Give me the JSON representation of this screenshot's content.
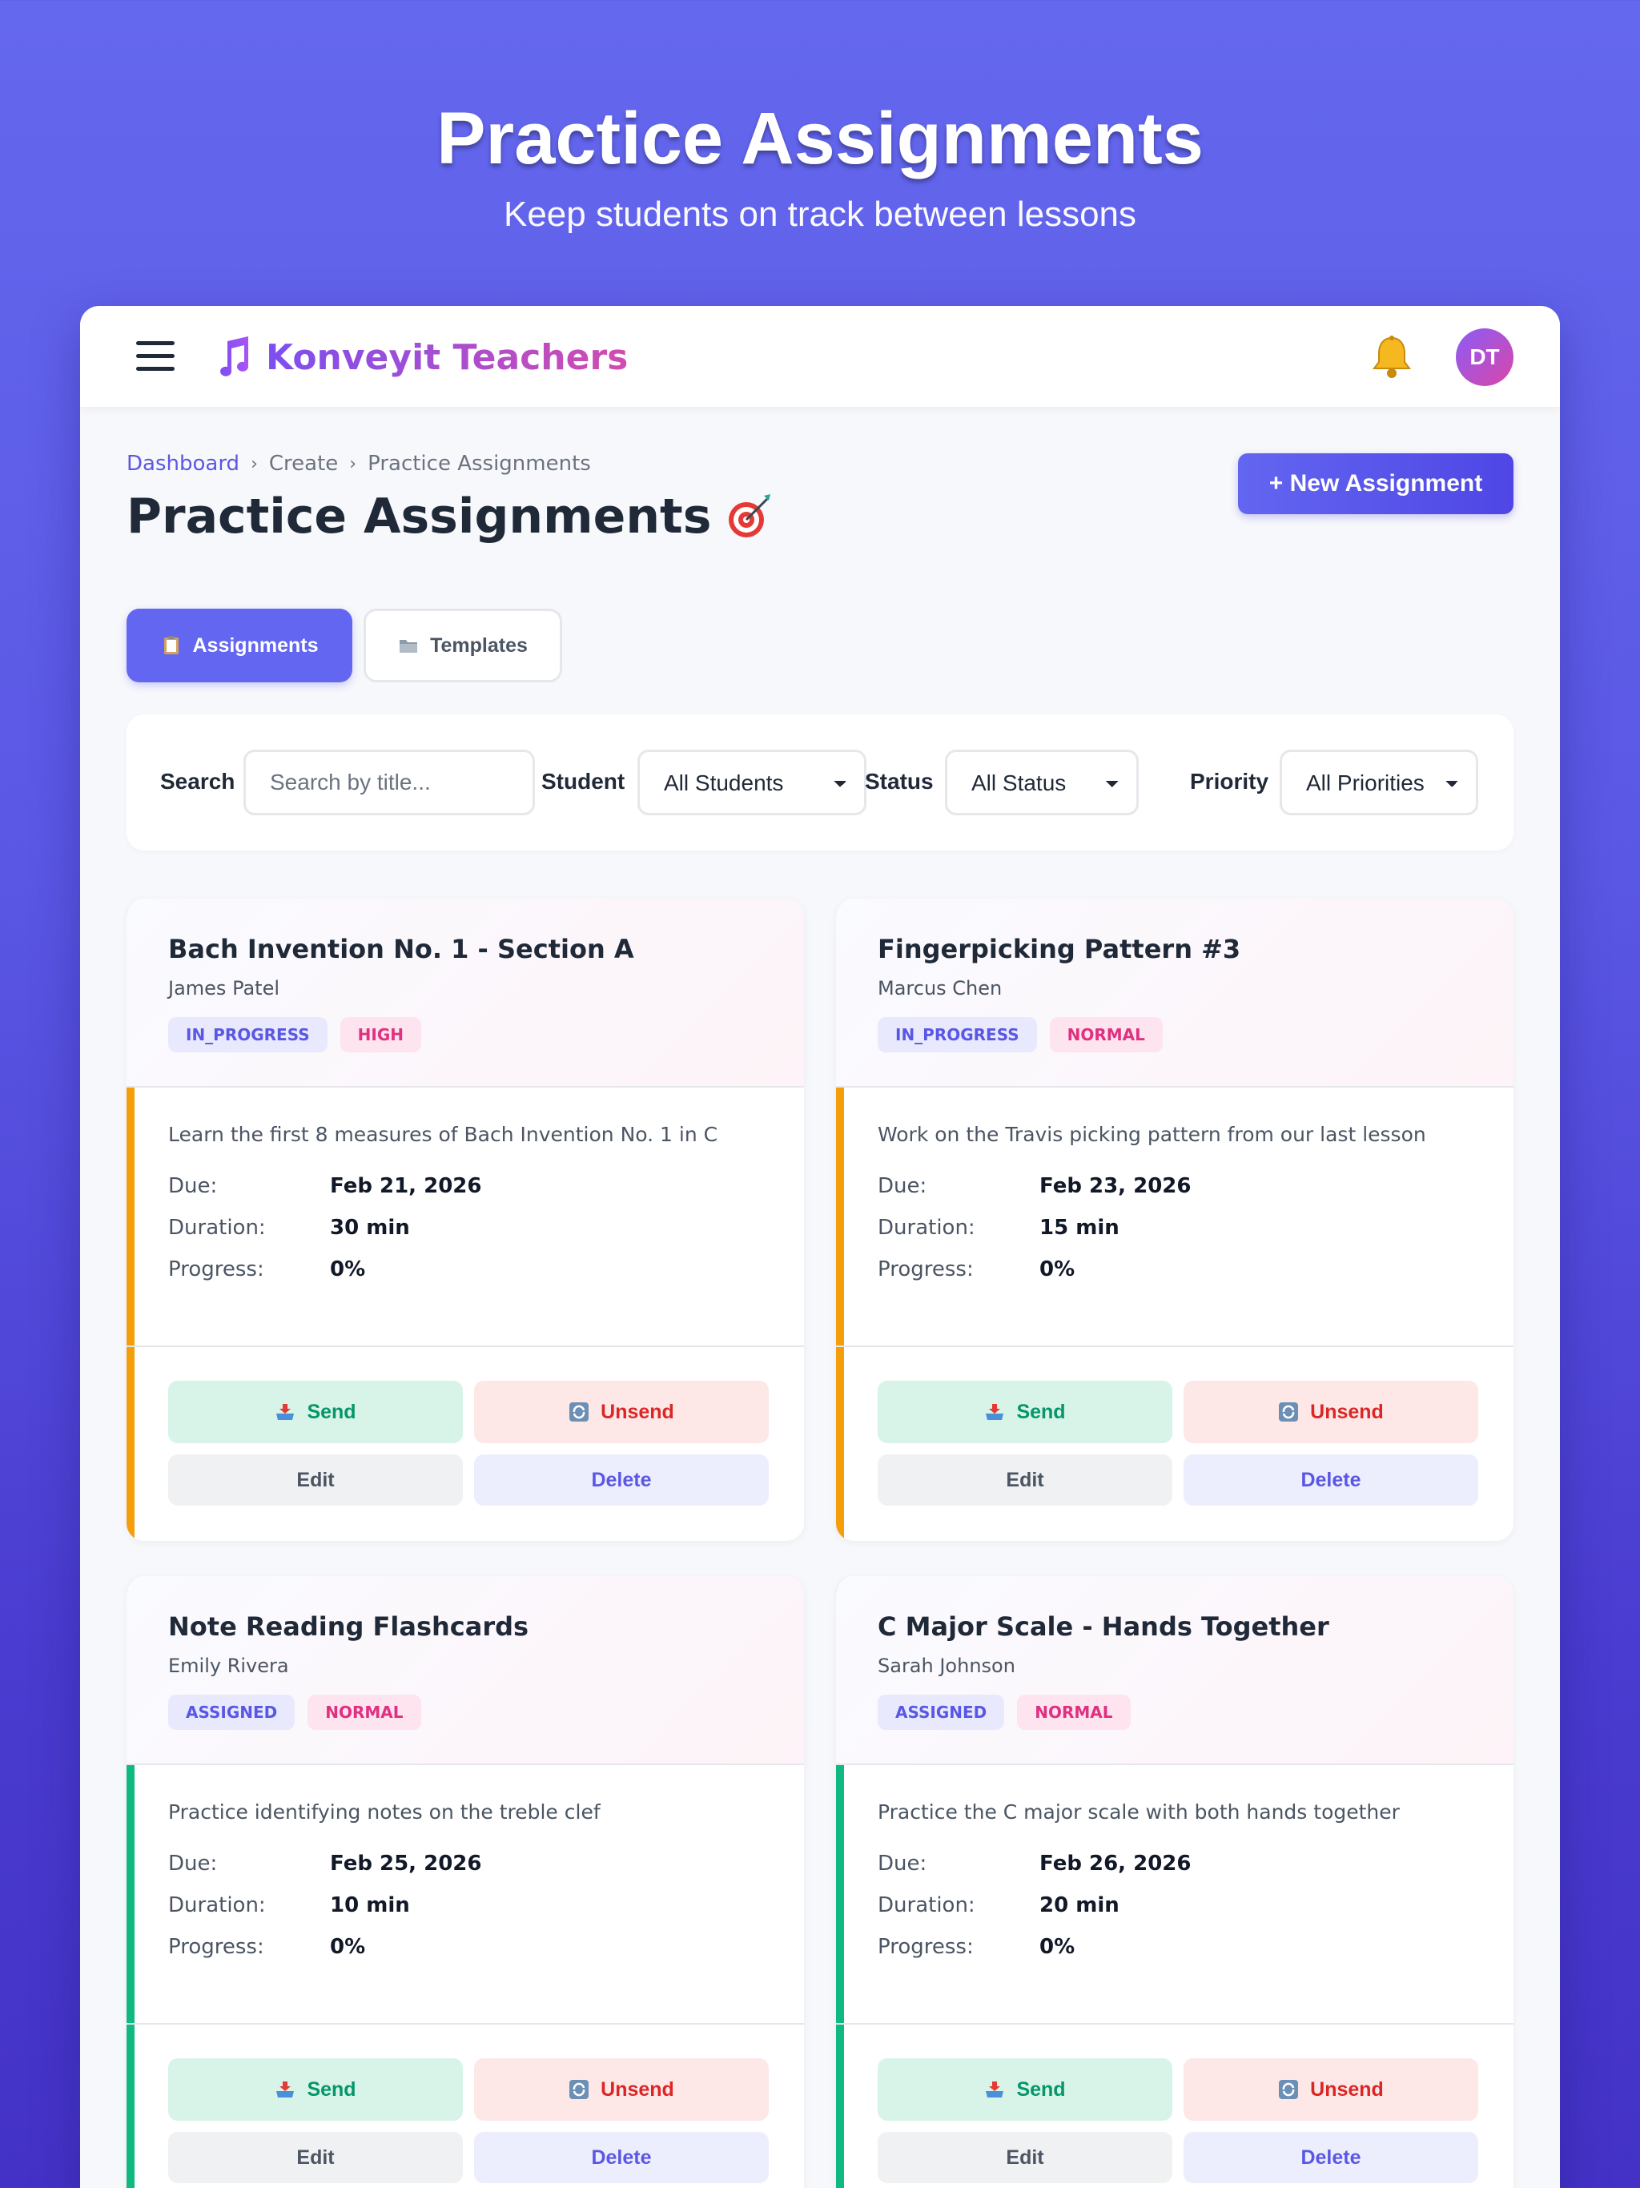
{
  "hero": {
    "title": "Practice Assignments",
    "subtitle": "Keep students on track between lessons"
  },
  "topbar": {
    "brand": "Konveyit Teachers",
    "avatar_initials": "DT"
  },
  "breadcrumb": [
    "Dashboard",
    "Create",
    "Practice Assignments"
  ],
  "page": {
    "title": "Practice Assignments",
    "new_button": "+ New Assignment"
  },
  "tabs": [
    {
      "label": "Assignments",
      "active": true
    },
    {
      "label": "Templates",
      "active": false
    }
  ],
  "filters": {
    "search_label": "Search",
    "search_placeholder": "Search by title...",
    "student_label": "Student",
    "student_value": "All Students",
    "status_label": "Status",
    "status_value": "All Status",
    "priority_label": "Priority",
    "priority_value": "All Priorities"
  },
  "meta_labels": {
    "due": "Due:",
    "duration": "Duration:",
    "progress": "Progress:"
  },
  "actions": {
    "send": "Send",
    "unsend": "Unsend",
    "edit": "Edit",
    "delete": "Delete"
  },
  "colors": {
    "in_progress_accent": "#f59e0b",
    "assigned_accent": "#10b981",
    "primary": "#6366f1"
  },
  "assignments": [
    {
      "title": "Bach Invention No. 1 - Section A",
      "student": "James Patel",
      "status": "IN_PROGRESS",
      "priority": "HIGH",
      "description": "Learn the first 8 measures of Bach Invention No. 1 in C",
      "due": "Feb 21, 2026",
      "duration": "30 min",
      "progress": "0%"
    },
    {
      "title": "Fingerpicking Pattern #3",
      "student": "Marcus Chen",
      "status": "IN_PROGRESS",
      "priority": "NORMAL",
      "description": "Work on the Travis picking pattern from our last lesson",
      "due": "Feb 23, 2026",
      "duration": "15 min",
      "progress": "0%"
    },
    {
      "title": "Note Reading Flashcards",
      "student": "Emily Rivera",
      "status": "ASSIGNED",
      "priority": "NORMAL",
      "description": "Practice identifying notes on the treble clef",
      "due": "Feb 25, 2026",
      "duration": "10 min",
      "progress": "0%"
    },
    {
      "title": "C Major Scale - Hands Together",
      "student": "Sarah Johnson",
      "status": "ASSIGNED",
      "priority": "NORMAL",
      "description": "Practice the C major scale with both hands together",
      "due": "Feb 26, 2026",
      "duration": "20 min",
      "progress": "0%"
    }
  ]
}
